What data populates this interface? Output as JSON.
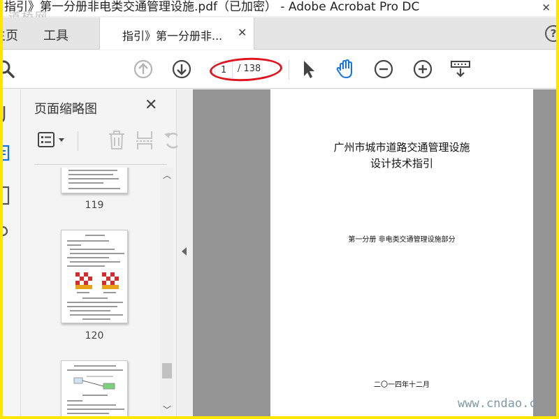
{
  "window": {
    "title": "指引》第一分册非电类交通管理设施.pdf（已加密） - Adobe Acrobat Pro DC",
    "watermark_top": "道桥网",
    "close_glyph": "✕"
  },
  "tabs": {
    "home": "主页",
    "tools": "工具",
    "document": "指引》第一分册非...",
    "close_glyph": "✕",
    "help_glyph": "?"
  },
  "toolbar": {
    "current_page": "1",
    "total_pages": "/ 138",
    "annotation_color": "#e0141e",
    "icons": [
      "search-icon",
      "page-up-icon",
      "page-down-icon",
      "select-arrow-icon",
      "hand-tool-icon",
      "zoom-out-icon",
      "zoom-in-icon",
      "reading-mode-icon"
    ]
  },
  "panel": {
    "title": "页面缩略图",
    "close_glyph": "✕",
    "thumbnails": [
      {
        "label": "119"
      },
      {
        "label": "120"
      },
      {
        "label": ""
      }
    ]
  },
  "document": {
    "title_line1": "广州市城市道路交通管理设施",
    "title_line2": "设计技术指引",
    "subtitle": "第一分册  非电类交通管理设施部分",
    "date": "二〇一四年十二月"
  },
  "watermark_bottom": "www.cndao.c",
  "colors": {
    "accent_blue": "#1473e6",
    "frame_yellow": "#ffe600",
    "doc_background": "#959595"
  }
}
